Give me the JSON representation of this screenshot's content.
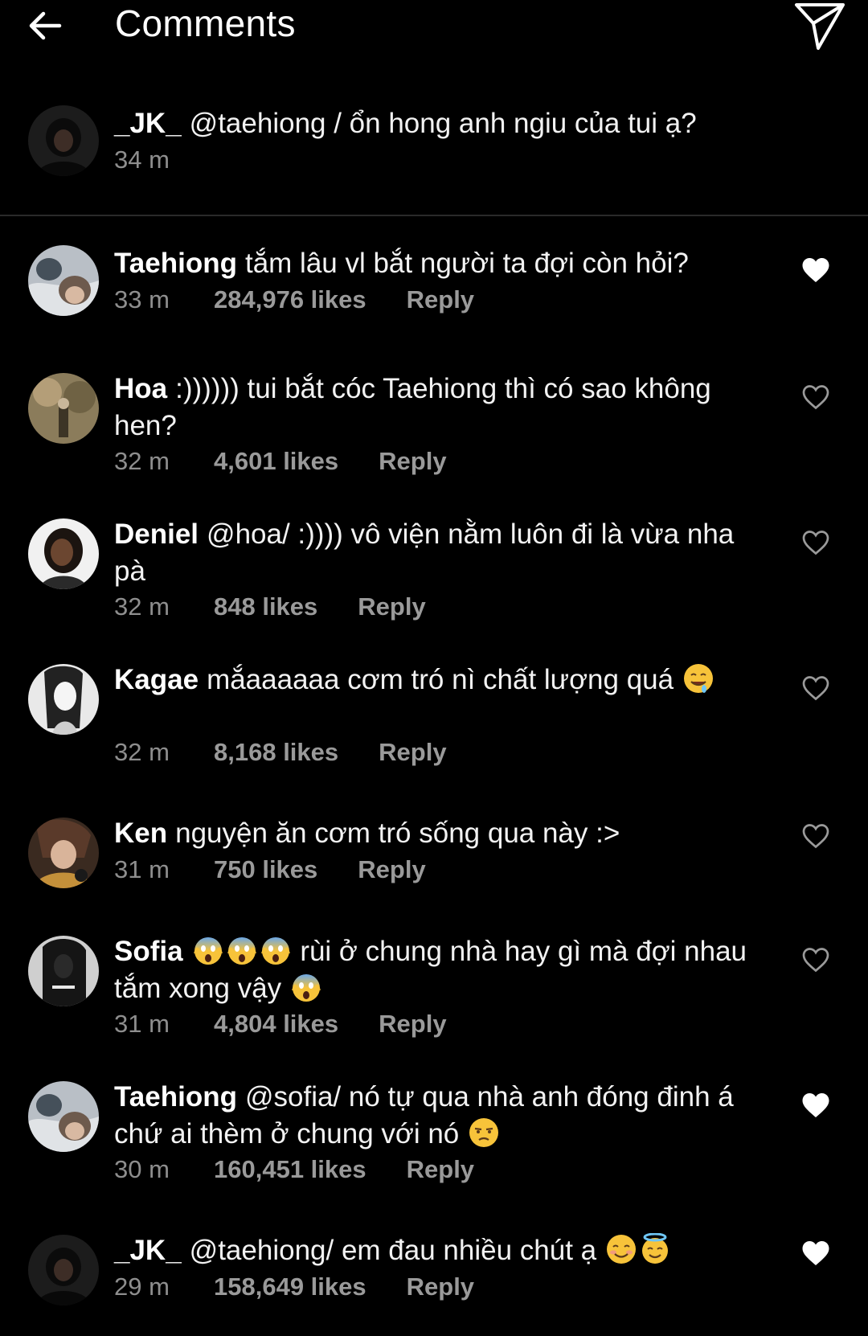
{
  "header": {
    "title": "Comments",
    "back_icon": "arrow-left-icon",
    "share_icon": "paper-plane-icon"
  },
  "caption": {
    "username": "_JK_",
    "text": "@taehiong / ổn hong anh ngiu của tui ạ?",
    "time": "34 m"
  },
  "reply_label": "Reply",
  "comments": [
    {
      "username": "Taehiong",
      "text": "tắm lâu vl bắt người ta đợi còn hỏi?",
      "time": "33 m",
      "likes": "284,976 likes",
      "liked": true
    },
    {
      "username": "Hoa",
      "text": ":)))))) tui bắt cóc Taehiong thì có sao không hen?",
      "time": "32 m",
      "likes": "4,601 likes",
      "liked": false
    },
    {
      "username": "Deniel",
      "text": "@hoa/ :)))) vô viện nằm luôn đi là vừa nha pà",
      "time": "32 m",
      "likes": "848 likes",
      "liked": false
    },
    {
      "username": "Kagae",
      "text": "mắaaaaaa cơm tró nì chất lượng quá",
      "emoji_after": "drooling-face-emoji",
      "time": "32 m",
      "likes": "8,168 likes",
      "liked": false
    },
    {
      "username": "Ken",
      "text": "nguyện ăn cơm tró sống qua này :>",
      "time": "31 m",
      "likes": "750 likes",
      "liked": false
    },
    {
      "username": "Sofia",
      "text_a": "rùi ở chung nhà hay gì mà đợi nhau tắm xong vậy",
      "emoji_before": "screaming-face-emoji",
      "emoji_after": "screaming-face-emoji",
      "time": "31 m",
      "likes": "4,804 likes",
      "liked": false
    },
    {
      "username": "Taehiong",
      "text": "@sofia/ nó tự qua nhà anh đóng đinh á chứ ai thèm ở chung với nó",
      "emoji_after": "unamused-face-emoji",
      "time": "30 m",
      "likes": "160,451 likes",
      "liked": true
    },
    {
      "username": "_JK_",
      "text": "@taehiong/ em đau nhiều chút ạ",
      "emoji_after": "smiling-face-halo-emoji",
      "time": "29 m",
      "likes": "158,649 likes",
      "liked": true
    }
  ],
  "colors": {
    "background": "#000000",
    "text": "#ffffff",
    "meta": "#8e8e8e",
    "divider": "#2a2a2a"
  }
}
